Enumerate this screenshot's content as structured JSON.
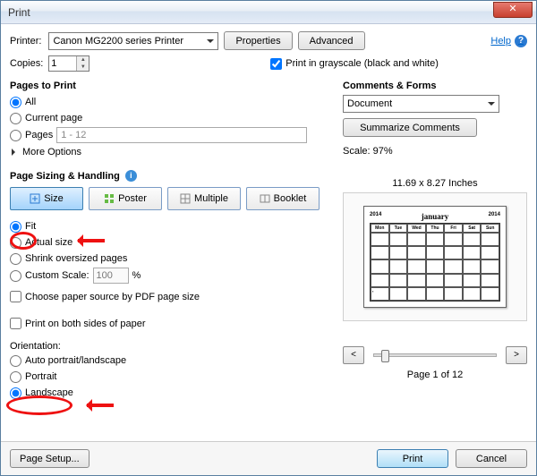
{
  "window": {
    "title": "Print"
  },
  "labels": {
    "printer": "Printer:",
    "copies": "Copies:",
    "properties": "Properties",
    "advanced": "Advanced",
    "help": "Help",
    "print_grayscale": "Print in grayscale (black and white)",
    "pages_to_print": "Pages to Print",
    "all": "All",
    "current_page": "Current page",
    "pages": "Pages",
    "more_options": "More Options",
    "page_sizing": "Page Sizing & Handling",
    "size": "Size",
    "poster": "Poster",
    "multiple": "Multiple",
    "booklet": "Booklet",
    "fit": "Fit",
    "actual_size": "Actual size",
    "shrink": "Shrink oversized pages",
    "custom_scale": "Custom Scale:",
    "choose_paper": "Choose paper source by PDF page size",
    "both_sides": "Print on both sides of paper",
    "orientation": "Orientation:",
    "auto_orient": "Auto portrait/landscape",
    "portrait": "Portrait",
    "landscape": "Landscape",
    "comments_forms": "Comments & Forms",
    "summarize": "Summarize Comments",
    "scale": "Scale:  97%",
    "page_setup": "Page Setup...",
    "print": "Print",
    "cancel": "Cancel",
    "percent": "%"
  },
  "values": {
    "printer_selected": "Canon MG2200 series Printer",
    "copies": "1",
    "pages_range": "1 - 12",
    "custom_scale_value": "100",
    "comments_selected": "Document",
    "preview_dim": "11.69 x 8.27 Inches",
    "page_of": "Page 1 of 12"
  },
  "state": {
    "grayscale_checked": true,
    "pages_radio": "all",
    "sizing_radio": "fit",
    "choose_paper_checked": false,
    "both_sides_checked": false,
    "orientation_radio": "landscape"
  }
}
